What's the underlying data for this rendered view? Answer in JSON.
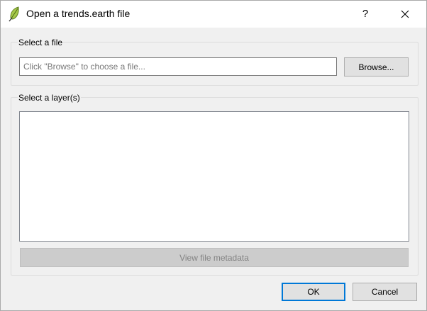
{
  "window": {
    "title": "Open a trends.earth file",
    "help_label": "?",
    "app_icon": "trends-earth-leaf-icon",
    "close_icon": "close-icon"
  },
  "file_group": {
    "title": "Select a file",
    "input_value": "",
    "input_placeholder": "Click \"Browse\" to choose a file...",
    "browse_label": "Browse..."
  },
  "layer_group": {
    "title": "Select a layer(s)",
    "layers": [],
    "metadata_button_label": "View file metadata"
  },
  "buttons": {
    "ok_label": "OK",
    "cancel_label": "Cancel"
  },
  "colors": {
    "accent": "#0078d7",
    "dialog_background": "#f0f0f0",
    "titlebar_background": "#ffffff"
  }
}
